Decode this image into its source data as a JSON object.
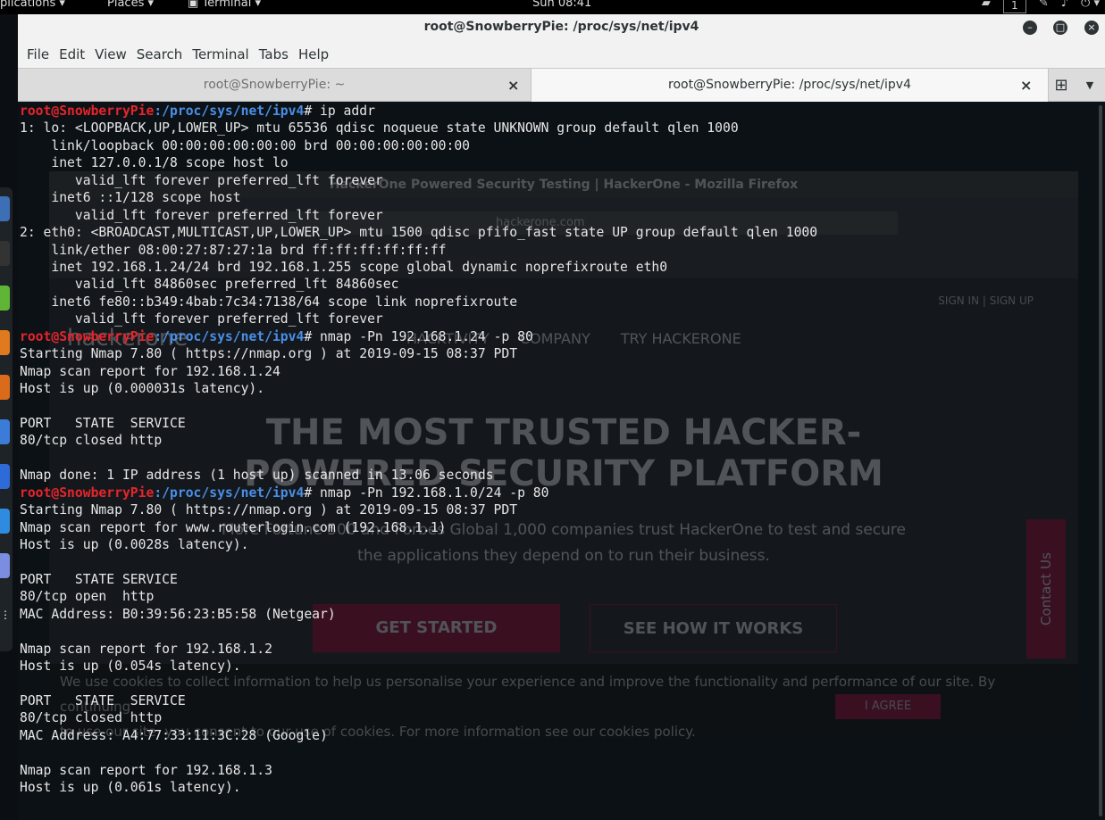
{
  "top_panel": {
    "applications": "plications ▾",
    "places": "Places ▾",
    "terminal": "Terminal ▾",
    "clock": "Sun 08:41",
    "workspace": "1"
  },
  "window": {
    "title": "root@SnowberryPie: /proc/sys/net/ipv4"
  },
  "menu": [
    "File",
    "Edit",
    "View",
    "Search",
    "Terminal",
    "Tabs",
    "Help"
  ],
  "tabs": [
    {
      "label": "root@SnowberryPie: ~",
      "close": "×"
    },
    {
      "label": "root@SnowberryPie: /proc/sys/net/ipv4",
      "close": "×"
    }
  ],
  "new_tab_icon": "⊞",
  "tab_menu_icon": "▼",
  "background_window": {
    "title": "HackerOne Powered Security Testing | HackerOne - Mozilla Firefox",
    "url": "hackerone.com",
    "signin": "SIGN IN | SIGN UP",
    "brand": "hackerone",
    "nav": [
      "HACKTIVITY",
      "COMPANY",
      "TRY HACKERONE"
    ],
    "hero_line1": "THE MOST TRUSTED HACKER-",
    "hero_line2": "POWERED SECURITY PLATFORM",
    "sub_line1": "More Fortune 500 and Forbes Global 1,000 companies trust HackerOne to test and secure",
    "sub_line2": "the applications they depend on to run their business.",
    "get_started": "GET STARTED",
    "see_how": "SEE HOW IT WORKS",
    "contact": "Contact Us",
    "cookie_line1": "We use cookies to collect information to help us personalise your experience and improve the functionality and performance of our site. By continuing",
    "cookie_line2": "to use our site, you consent to our use of cookies. For more information see our cookies policy.",
    "agree": "I AGREE"
  },
  "prompt": {
    "user": "root@SnowberryPie",
    "path": ":/proc/sys/net/ipv4",
    "symbol": "# "
  },
  "terminal_lines": [
    {
      "prompt": true,
      "cmd": "ip addr"
    },
    {
      "text": "1: lo: <LOOPBACK,UP,LOWER_UP> mtu 65536 qdisc noqueue state UNKNOWN group default qlen 1000"
    },
    {
      "text": "    link/loopback 00:00:00:00:00:00 brd 00:00:00:00:00:00"
    },
    {
      "text": "    inet 127.0.0.1/8 scope host lo"
    },
    {
      "text": "       valid_lft forever preferred_lft forever"
    },
    {
      "text": "    inet6 ::1/128 scope host"
    },
    {
      "text": "       valid_lft forever preferred_lft forever"
    },
    {
      "text": "2: eth0: <BROADCAST,MULTICAST,UP,LOWER_UP> mtu 1500 qdisc pfifo_fast state UP group default qlen 1000"
    },
    {
      "text": "    link/ether 08:00:27:87:27:1a brd ff:ff:ff:ff:ff:ff"
    },
    {
      "text": "    inet 192.168.1.24/24 brd 192.168.1.255 scope global dynamic noprefixroute eth0"
    },
    {
      "text": "       valid_lft 84860sec preferred_lft 84860sec"
    },
    {
      "text": "    inet6 fe80::b349:4bab:7c34:7138/64 scope link noprefixroute"
    },
    {
      "text": "       valid_lft forever preferred_lft forever"
    },
    {
      "prompt": true,
      "cmd": "nmap -Pn 192.168.1.24 -p 80"
    },
    {
      "text": "Starting Nmap 7.80 ( https://nmap.org ) at 2019-09-15 08:37 PDT"
    },
    {
      "text": "Nmap scan report for 192.168.1.24"
    },
    {
      "text": "Host is up (0.000031s latency)."
    },
    {
      "text": ""
    },
    {
      "text": "PORT   STATE  SERVICE"
    },
    {
      "text": "80/tcp closed http"
    },
    {
      "text": ""
    },
    {
      "text": "Nmap done: 1 IP address (1 host up) scanned in 13.06 seconds"
    },
    {
      "prompt": true,
      "cmd": "nmap -Pn 192.168.1.0/24 -p 80"
    },
    {
      "text": "Starting Nmap 7.80 ( https://nmap.org ) at 2019-09-15 08:37 PDT"
    },
    {
      "text": "Nmap scan report for www.routerlogin.com (192.168.1.1)"
    },
    {
      "text": "Host is up (0.0028s latency)."
    },
    {
      "text": ""
    },
    {
      "text": "PORT   STATE SERVICE"
    },
    {
      "text": "80/tcp open  http"
    },
    {
      "text": "MAC Address: B0:39:56:23:B5:58 (Netgear)"
    },
    {
      "text": ""
    },
    {
      "text": "Nmap scan report for 192.168.1.2"
    },
    {
      "text": "Host is up (0.054s latency)."
    },
    {
      "text": ""
    },
    {
      "text": "PORT   STATE  SERVICE"
    },
    {
      "text": "80/tcp closed http"
    },
    {
      "text": "MAC Address: A4:77:33:11:3C:28 (Google)"
    },
    {
      "text": ""
    },
    {
      "text": "Nmap scan report for 192.168.1.3"
    },
    {
      "text": "Host is up (0.061s latency)."
    }
  ],
  "colors": {
    "prompt_user": "#e5252c",
    "prompt_path": "#4a8fe6",
    "terminal_bg": "#0c1116",
    "terminal_fg": "#e6e6e6"
  }
}
